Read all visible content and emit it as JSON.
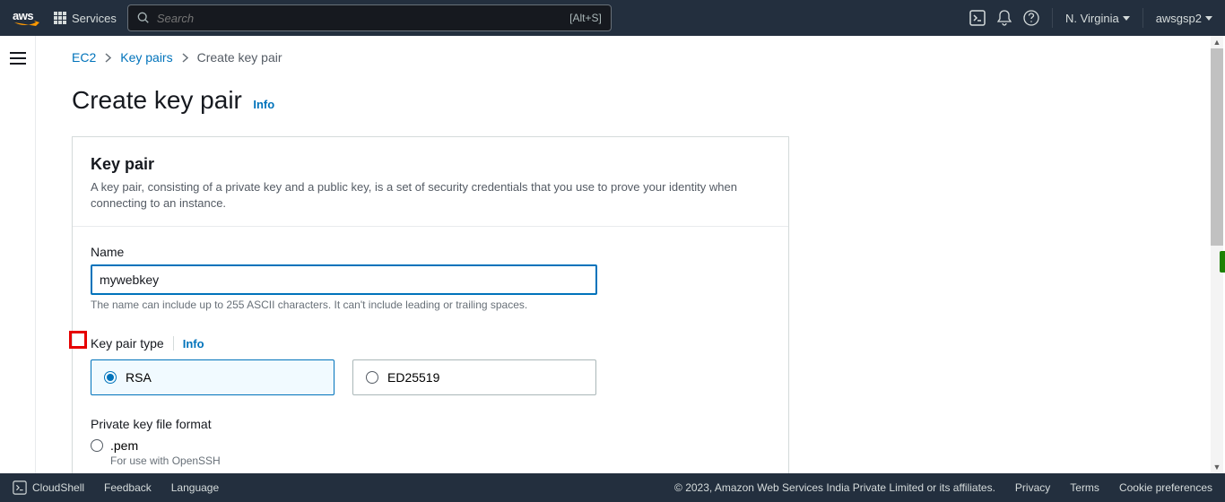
{
  "nav": {
    "logo_text": "aws",
    "services_label": "Services",
    "search_placeholder": "Search",
    "search_hint": "[Alt+S]",
    "region": "N. Virginia",
    "account": "awsgsp2"
  },
  "breadcrumb": {
    "items": [
      {
        "label": "EC2",
        "link": true
      },
      {
        "label": "Key pairs",
        "link": true
      },
      {
        "label": "Create key pair",
        "link": false
      }
    ]
  },
  "page": {
    "title": "Create key pair",
    "info_label": "Info"
  },
  "panel": {
    "heading": "Key pair",
    "description": "A key pair, consisting of a private key and a public key, is a set of security credentials that you use to prove your identity when connecting to an instance."
  },
  "form": {
    "name_label": "Name",
    "name_value": "mywebkey",
    "name_hint": "The name can include up to 255 ASCII characters. It can't include leading or trailing spaces.",
    "type_label": "Key pair type",
    "type_info": "Info",
    "type_options": [
      {
        "label": "RSA",
        "selected": true
      },
      {
        "label": "ED25519",
        "selected": false
      }
    ],
    "format_label": "Private key file format",
    "format_options": [
      {
        "label": ".pem",
        "hint": "For use with OpenSSH",
        "selected": false
      }
    ]
  },
  "footer": {
    "cloudshell": "CloudShell",
    "feedback": "Feedback",
    "language": "Language",
    "copyright": "© 2023, Amazon Web Services India Private Limited or its affiliates.",
    "privacy": "Privacy",
    "terms": "Terms",
    "cookies": "Cookie preferences"
  }
}
